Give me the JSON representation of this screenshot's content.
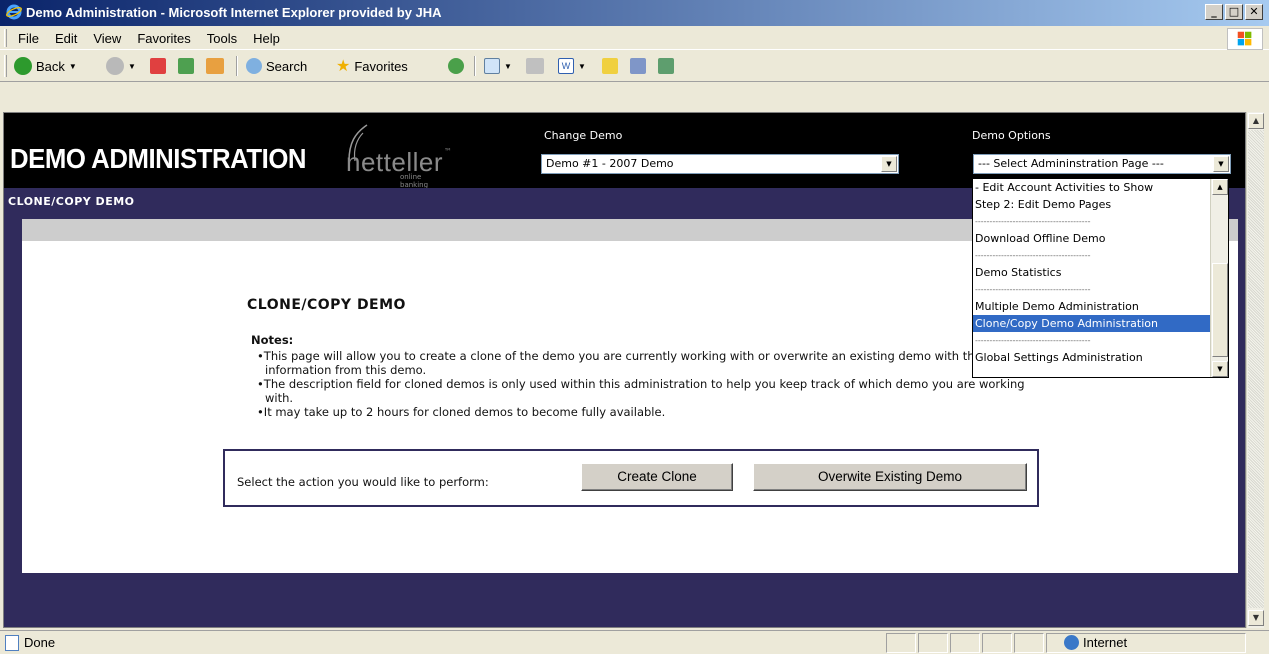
{
  "window": {
    "title": "Demo Administration - Microsoft Internet Explorer provided by JHA",
    "min": "_",
    "max": "□",
    "close": "✕"
  },
  "menu": [
    "File",
    "Edit",
    "View",
    "Favorites",
    "Tools",
    "Help"
  ],
  "toolbar": {
    "back": "Back",
    "search": "Search",
    "favorites": "Favorites"
  },
  "header": {
    "brand": "DEMO ADMINISTRATION",
    "logo_word": "netteller",
    "logo_tm": "™",
    "logo_sub": "online banking",
    "change_demo_label": "Change Demo",
    "change_demo_value": "Demo #1 - 2007 Demo",
    "demo_options_label": "Demo Options",
    "demo_options_value": "--- Select Admininstration Page ---"
  },
  "subheader": {
    "title": "CLONE/COPY DEMO"
  },
  "page": {
    "heading": "CLONE/COPY DEMO",
    "notes_title": "Notes:",
    "notes": [
      "This page will allow you to create a clone of the demo you are currently working with or overwrite an existing demo with the information from this demo.",
      "The description field for cloned demos is only used within this administration to help you keep track of which demo you are working with.",
      "It may take up to 2 hours for cloned demos to become fully available."
    ],
    "action_label": "Select the action you would like to perform:",
    "create_clone": "Create Clone",
    "overwrite": "Overwite Existing Demo"
  },
  "dropdown": {
    "options": [
      "- Edit Account Activities to Show",
      "Step 2: Edit Demo Pages",
      "----------------------------------------",
      "Download Offline Demo",
      "----------------------------------------",
      "Demo Statistics",
      "----------------------------------------",
      "Multiple Demo Administration",
      "Clone/Copy Demo Administration",
      "----------------------------------------",
      "Global Settings Administration"
    ],
    "selected_index": 8
  },
  "status": {
    "text": "Done",
    "zone": "Internet"
  },
  "colors": {
    "navy": "#302b5c",
    "title_start": "#0a246a",
    "selection": "#316ac5"
  }
}
